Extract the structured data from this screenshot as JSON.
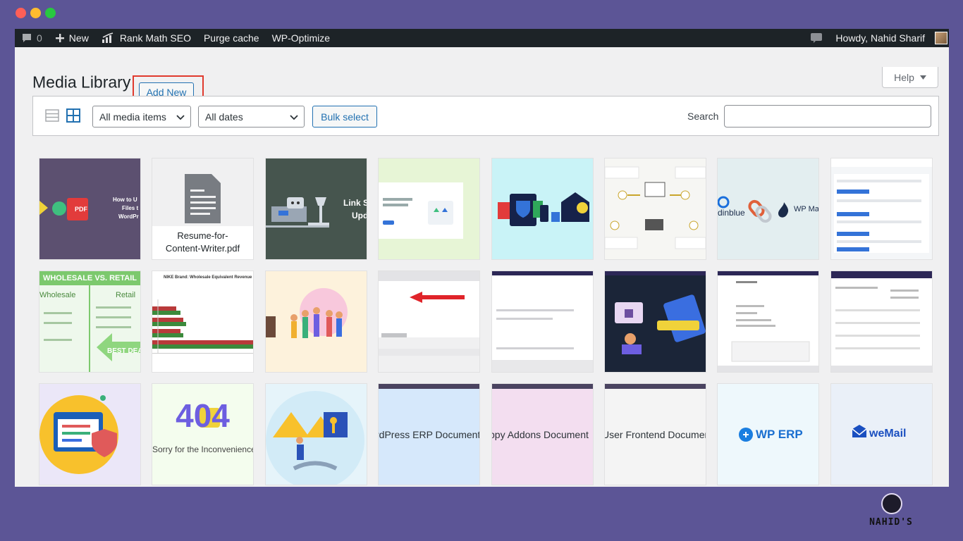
{
  "adminbar": {
    "comments_count": "0",
    "new_label": "New",
    "rank_math_label": "Rank Math SEO",
    "purge_cache_label": "Purge cache",
    "wp_optimize_label": "WP-Optimize",
    "howdy_label": "Howdy, Nahid Sharif"
  },
  "header": {
    "title": "Media Library",
    "add_new_label": "Add New",
    "help_label": "Help"
  },
  "filters": {
    "media_type_selected": "All media items",
    "date_selected": "All dates",
    "bulk_select_label": "Bulk select",
    "search_label": "Search",
    "search_value": ""
  },
  "tiles": {
    "t1_text_1": "How to U",
    "t1_text_2": "Files t",
    "t1_text_3": "WordPr",
    "t1_pdf": "PDF",
    "t2_file_1": "Resume-for-",
    "t2_file_2": "Content-Writer.pdf",
    "t3_text_1": "Link S",
    "t3_text_2": "Upd",
    "t7_text_1": "dinblue",
    "t7_text_2": "WP Mai",
    "t9_header": "WHOLESALE VS. RETAIL",
    "t9_left": "Wholesale",
    "t9_right": "Retail",
    "t9_arrow": "BEST DEA",
    "t10_title": "NIKE Brand: Wholesale Equivalent Revenue",
    "t17_404": "404",
    "t17_sub": "Sorry for the Inconvenience",
    "t20_text": "rdPress ERP Document",
    "t21_text": "ppy Addons Document",
    "t22_text": "User Frontend Documer",
    "t23_text": "WP ERP",
    "t24_text": "weMail"
  },
  "brand": {
    "name": "NAHID'S"
  },
  "colors": {
    "adminbar_bg": "#1d2327",
    "wp_blue": "#2271b1",
    "highlight_red": "#e03a2e",
    "frame_purple": "#5c5596"
  }
}
